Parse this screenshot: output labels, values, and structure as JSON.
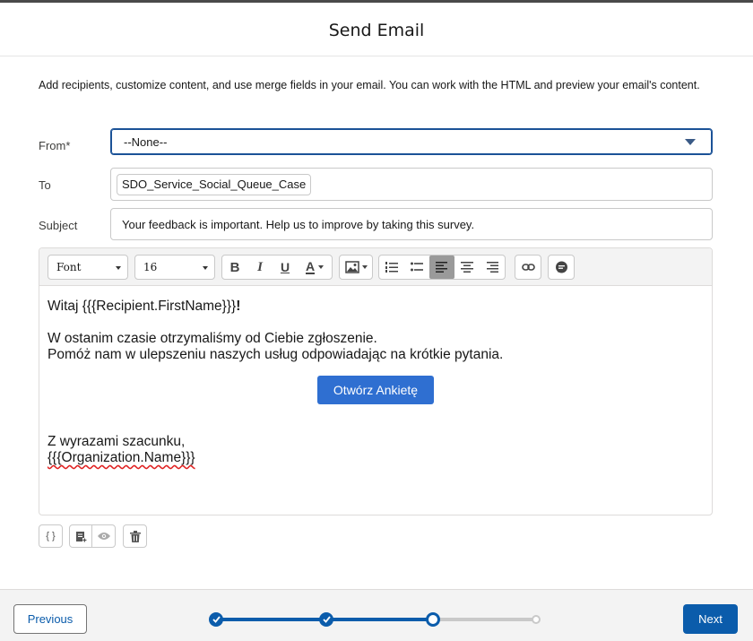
{
  "modal": {
    "title": "Send Email"
  },
  "description": "Add recipients, customize content, and use merge fields in your email. You can work with the HTML and preview your email's content.",
  "form": {
    "from_label": "From*",
    "from_value": "--None--",
    "to_label": "To",
    "to_recipient": "SDO_Service_Social_Queue_Case",
    "subject_label": "Subject",
    "subject_value": "Your feedback is important. Help us to improve by taking this survey."
  },
  "toolbar": {
    "font_value": "Font",
    "size_value": "16",
    "bold_glyph": "B",
    "italic_glyph": "I",
    "underline_glyph": "U",
    "color_glyph": "A"
  },
  "email_body": {
    "greeting": "Witaj {{{Recipient.FirstName}}}",
    "greeting_mark": "!",
    "line1": "W ostanim czasie otrzymaliśmy od Ciebie zgłoszenie.",
    "line2": "Pomóż nam w ulepszeniu naszych usług odpowiadając na krótkie pytania.",
    "cta_label": "Otwórz Ankietę",
    "signoff": "Z wyrazami szacunku,",
    "signature": "{{{Organization.Name}}}"
  },
  "bottom_tools": {
    "merge_glyph": "{ }"
  },
  "footer": {
    "previous_label": "Previous",
    "next_label": "Next",
    "progress": {
      "total_steps": 4,
      "current_step": 3
    }
  },
  "colors": {
    "brand": "#0b5cab",
    "cta": "#2f6fd1"
  }
}
